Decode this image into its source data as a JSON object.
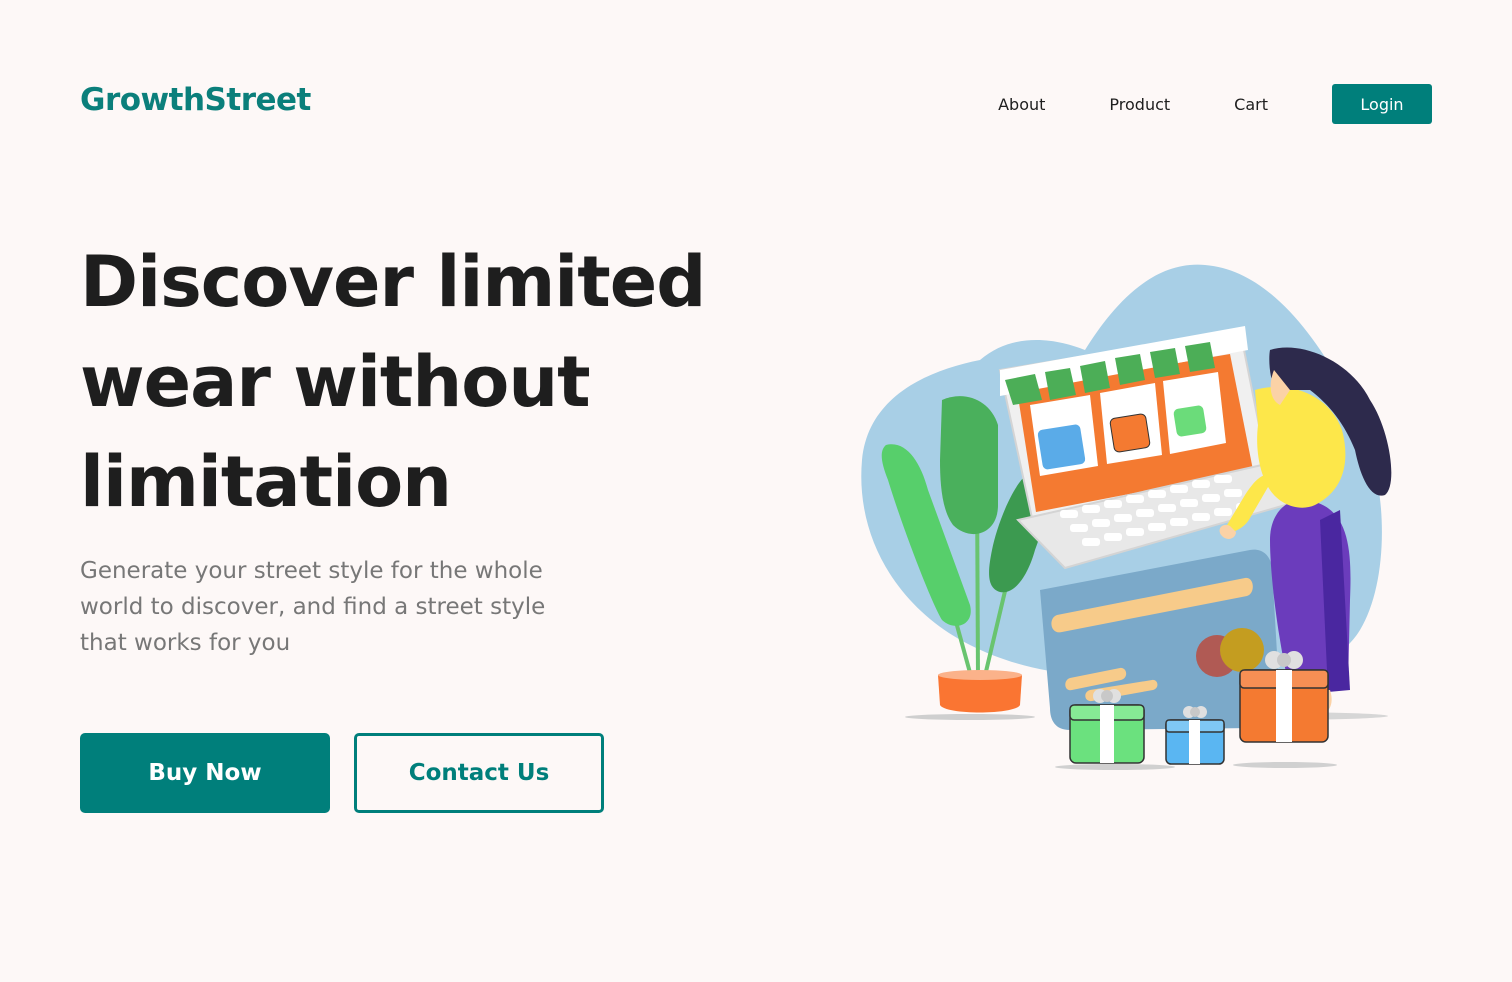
{
  "header": {
    "logo": "GrowthStreet",
    "nav": {
      "about": "About",
      "product": "Product",
      "cart": "Cart",
      "login": "Login"
    }
  },
  "hero": {
    "title": "Discover limited wear without limitation",
    "subtitle": "Generate your street style for the whole world to discover, and find a street style that works for you",
    "buy_now": "Buy Now",
    "contact_us": "Contact Us"
  },
  "colors": {
    "brand": "#007f7b",
    "background": "#fdf8f7"
  },
  "illustration": {
    "icon": "online-shopping-illustration"
  }
}
